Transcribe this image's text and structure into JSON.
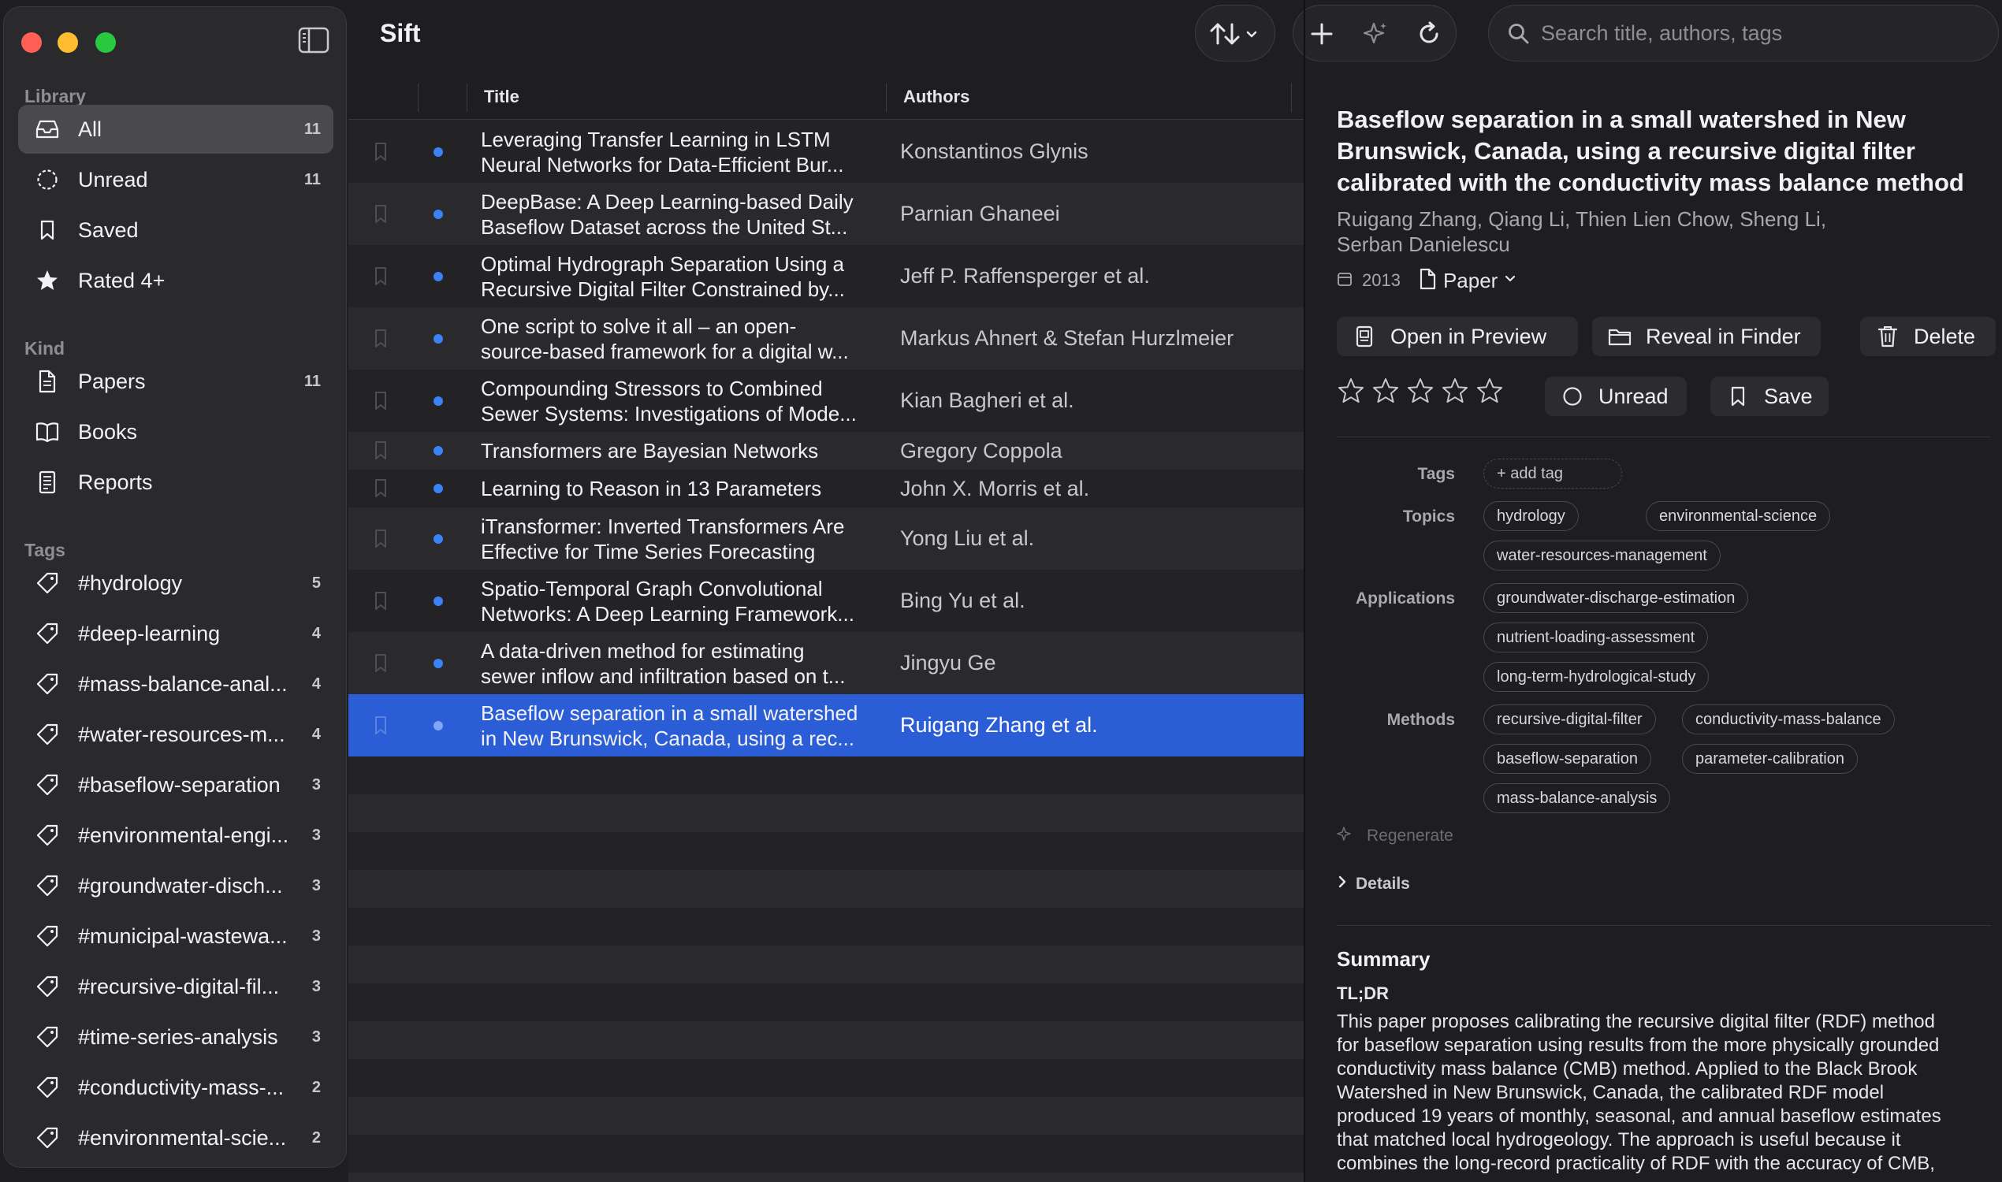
{
  "app": {
    "title": "Sift"
  },
  "sidebar": {
    "library_label": "Library",
    "library": [
      {
        "label": "All",
        "count": "11",
        "icon": "tray-icon",
        "active": true
      },
      {
        "label": "Unread",
        "count": "11",
        "icon": "dotted-circle-icon"
      },
      {
        "label": "Saved",
        "count": "",
        "icon": "bookmark-icon"
      },
      {
        "label": "Rated 4+",
        "count": "",
        "icon": "star-icon"
      }
    ],
    "kind_label": "Kind",
    "kind": [
      {
        "label": "Papers",
        "count": "11",
        "icon": "document-icon"
      },
      {
        "label": "Books",
        "count": "",
        "icon": "book-icon"
      },
      {
        "label": "Reports",
        "count": "",
        "icon": "report-icon"
      }
    ],
    "tags_label": "Tags",
    "tags": [
      {
        "label": "#hydrology",
        "count": "5"
      },
      {
        "label": "#deep-learning",
        "count": "4"
      },
      {
        "label": "#mass-balance-anal...",
        "count": "4"
      },
      {
        "label": "#water-resources-m...",
        "count": "4"
      },
      {
        "label": "#baseflow-separation",
        "count": "3"
      },
      {
        "label": "#environmental-engi...",
        "count": "3"
      },
      {
        "label": "#groundwater-disch...",
        "count": "3"
      },
      {
        "label": "#municipal-wastewa...",
        "count": "3"
      },
      {
        "label": "#recursive-digital-fil...",
        "count": "3"
      },
      {
        "label": "#time-series-analysis",
        "count": "3"
      },
      {
        "label": "#conductivity-mass-...",
        "count": "2"
      },
      {
        "label": "#environmental-scie...",
        "count": "2"
      }
    ]
  },
  "search": {
    "placeholder": "Search title, authors, tags"
  },
  "list": {
    "columns": {
      "title": "Title",
      "authors": "Authors"
    },
    "rows": [
      {
        "title": [
          "Leveraging Transfer Learning in LSTM",
          "Neural Networks for Data-Efficient Bur..."
        ],
        "authors": "Konstantinos Glynis"
      },
      {
        "title": [
          "DeepBase: A Deep Learning-based Daily",
          "Baseflow Dataset across the United St..."
        ],
        "authors": "Parnian Ghaneei"
      },
      {
        "title": [
          "Optimal Hydrograph Separation Using a",
          "Recursive Digital Filter Constrained by..."
        ],
        "authors": "Jeff P. Raffensperger et al."
      },
      {
        "title": [
          "One script to solve it all – an open-",
          "source-based framework for a digital w..."
        ],
        "authors": "Markus Ahnert & Stefan Hurzlmeier"
      },
      {
        "title": [
          "Compounding Stressors to Combined",
          "Sewer Systems: Investigations of Mode..."
        ],
        "authors": "Kian Bagheri et al."
      },
      {
        "title": [
          "Transformers are Bayesian Networks"
        ],
        "authors": "Gregory Coppola"
      },
      {
        "title": [
          "Learning to Reason in 13 Parameters"
        ],
        "authors": "John X. Morris et al."
      },
      {
        "title": [
          "iTransformer: Inverted Transformers Are",
          "Effective for Time Series Forecasting"
        ],
        "authors": "Yong Liu et al."
      },
      {
        "title": [
          "Spatio-Temporal Graph Convolutional",
          "Networks: A Deep Learning Framework..."
        ],
        "authors": "Bing Yu et al."
      },
      {
        "title": [
          "A data-driven method for estimating",
          "sewer inflow and infiltration based on t..."
        ],
        "authors": "Jingyu Ge"
      },
      {
        "title": [
          "Baseflow separation in a small watershed",
          "in New Brunswick, Canada, using a rec..."
        ],
        "authors": "Ruigang Zhang et al.",
        "selected": true
      }
    ]
  },
  "detail": {
    "title": [
      "Baseflow separation in a small watershed in New",
      "Brunswick, Canada, using a recursive digital filter",
      "calibrated with the conductivity mass balance method"
    ],
    "authors": [
      "Ruigang Zhang, Qiang Li, Thien Lien Chow, Sheng Li,",
      "Serban Danielescu"
    ],
    "year": "2013",
    "kind": "Paper",
    "buttons": {
      "open": "Open in Preview",
      "reveal": "Reveal in Finder",
      "delete": "Delete",
      "unread": "Unread",
      "save": "Save"
    },
    "rating": 0,
    "labels": {
      "tags": "Tags",
      "topics": "Topics",
      "applications": "Applications",
      "methods": "Methods"
    },
    "add_tag": "+ add tag",
    "topics": [
      "hydrology",
      "environmental-science",
      "water-resources-management"
    ],
    "applications": [
      "groundwater-discharge-estimation",
      "nutrient-loading-assessment",
      "long-term-hydrological-study"
    ],
    "methods": [
      "recursive-digital-filter",
      "conductivity-mass-balance",
      "baseflow-separation",
      "parameter-calibration",
      "mass-balance-analysis"
    ],
    "regenerate": "Regenerate",
    "details": "Details",
    "summary_heading": "Summary",
    "summary_sub": "TL;DR",
    "summary": [
      "This paper proposes calibrating the recursive digital filter (RDF) method",
      "for baseflow separation using results from the more physically grounded",
      "conductivity mass balance (CMB) method. Applied to the Black Brook",
      "Watershed in New Brunswick, Canada, the calibrated RDF model",
      "produced 19 years of monthly, seasonal, and annual baseflow estimates",
      "that matched local hydrogeology. The approach is useful because it",
      "combines the long-record practicality of RDF with the accuracy of CMB,"
    ]
  },
  "colors": {
    "accent": "#2a5dd6",
    "unread_dot": "#3b82f6",
    "close": "#ff5f57",
    "minimize": "#febc2e",
    "maximize": "#28c840"
  }
}
